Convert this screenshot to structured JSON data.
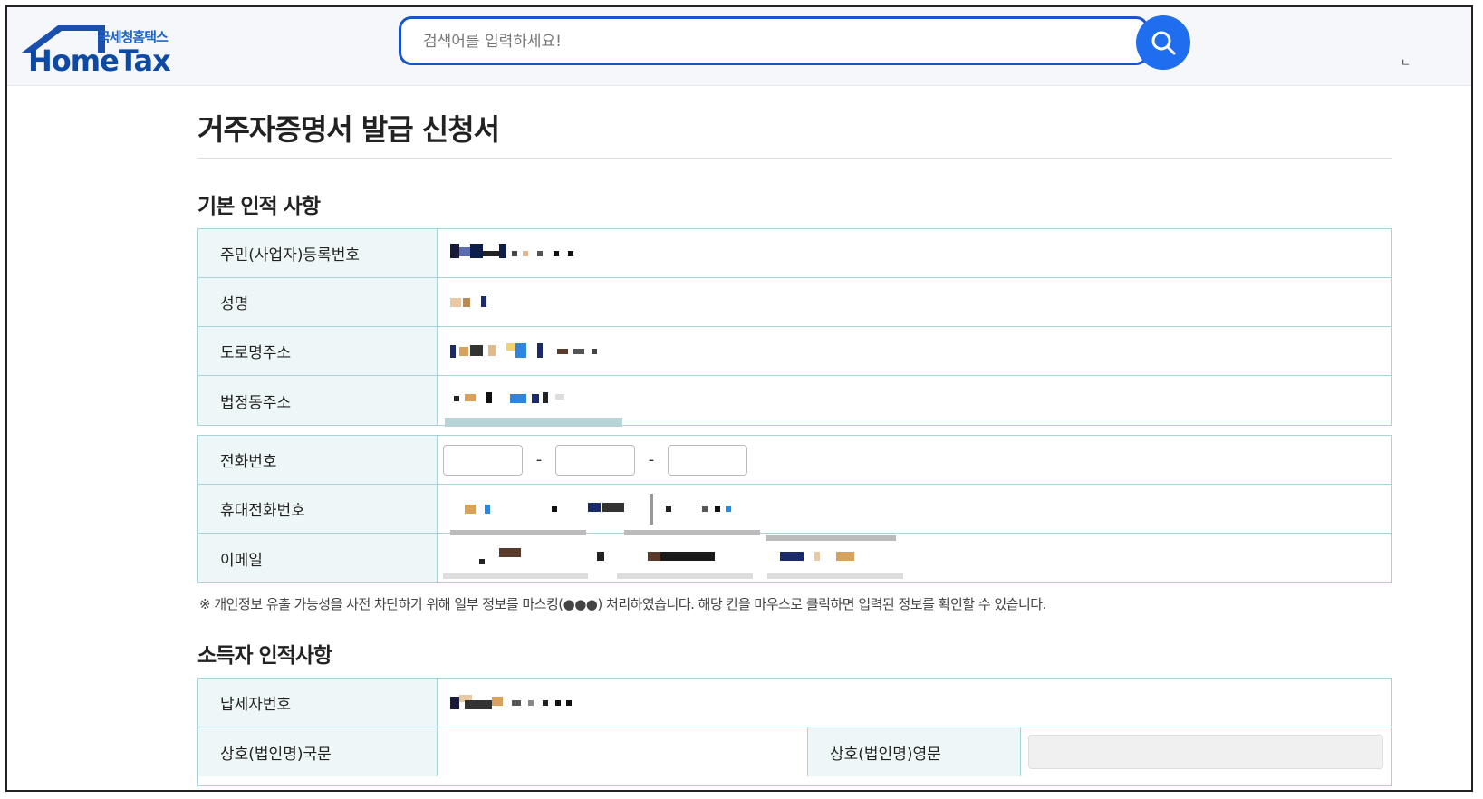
{
  "header": {
    "logo_small": "국세청홈택스",
    "logo_big": "HomeTax",
    "search_placeholder": "검색어를 입력하세요!",
    "edge_text": "ㄴ"
  },
  "page": {
    "title": "거주자증명서 발급 신청서"
  },
  "section_basic": {
    "title": "기본 인적 사항",
    "rows": [
      {
        "label": "주민(사업자)등록번호"
      },
      {
        "label": "성명"
      },
      {
        "label": "도로명주소"
      },
      {
        "label": "법정동주소"
      }
    ]
  },
  "section_contact": {
    "rows": [
      {
        "label": "전화번호"
      },
      {
        "label": "휴대전화번호"
      },
      {
        "label": "이메일"
      }
    ],
    "dash": "-"
  },
  "privacy_note": "※ 개인정보 유출 가능성을 사전 차단하기 위해 일부 정보를 마스킹(●●●) 처리하였습니다. 해당 칸을 마우스로 클릭하면 입력된 정보를 확인할 수 있습니다.",
  "section_income": {
    "title": "소득자 인적사항",
    "rows": [
      {
        "label": "납세자번호"
      },
      {
        "label": "상호(법인명)국문",
        "label2": "상호(법인명)영문"
      }
    ]
  },
  "colors": {
    "accent": "#1f6ef0",
    "table_border": "#a9d3d6",
    "header_cell_bg": "#eef7f7"
  },
  "icons": {
    "search": "search-icon",
    "logo": "house-roof-icon"
  }
}
